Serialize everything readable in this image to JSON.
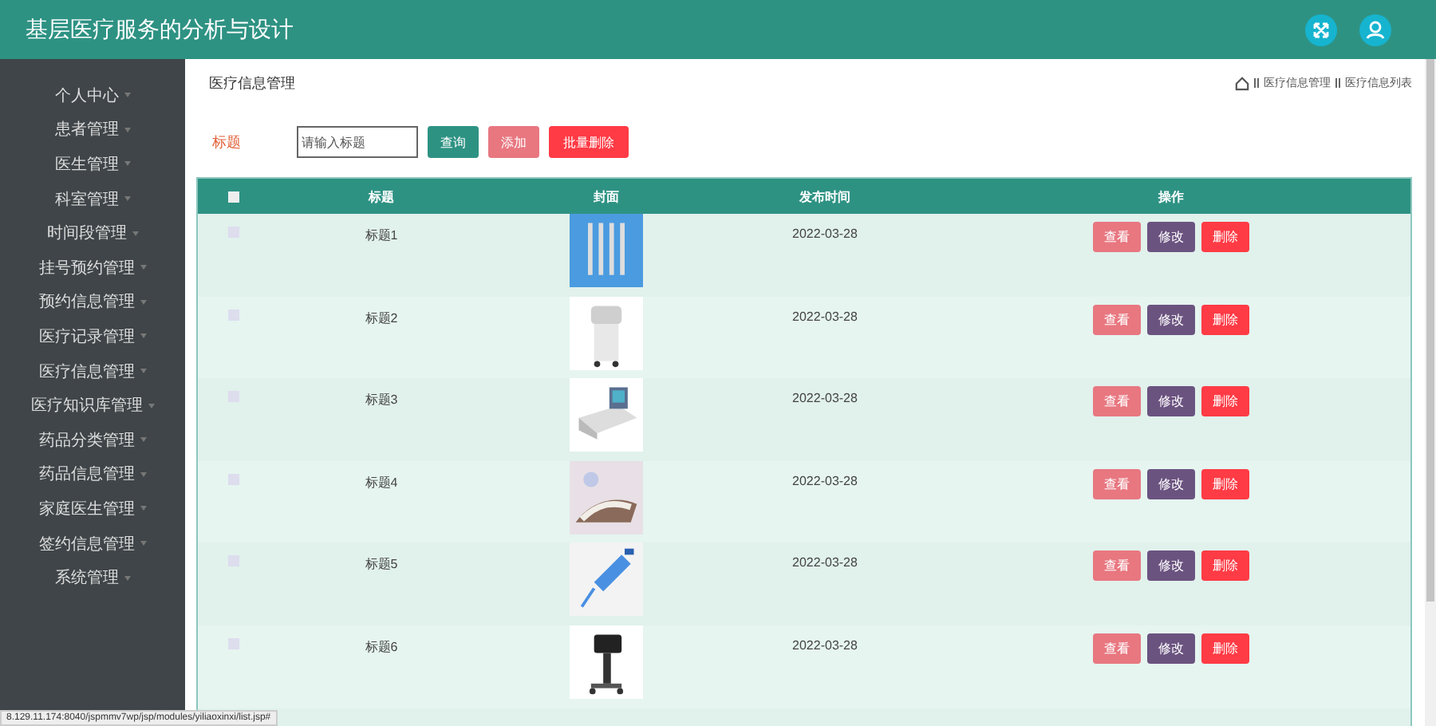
{
  "header": {
    "title": "基层医疗服务的分析与设计"
  },
  "sidebar": {
    "items": [
      {
        "label": "个人中心"
      },
      {
        "label": "患者管理"
      },
      {
        "label": "医生管理"
      },
      {
        "label": "科室管理"
      },
      {
        "label": "时间段管理"
      },
      {
        "label": "挂号预约管理"
      },
      {
        "label": "预约信息管理"
      },
      {
        "label": "医疗记录管理"
      },
      {
        "label": "医疗信息管理"
      },
      {
        "label": "医疗知识库管理"
      },
      {
        "label": "药品分类管理"
      },
      {
        "label": "药品信息管理"
      },
      {
        "label": "家庭医生管理"
      },
      {
        "label": "签约信息管理"
      },
      {
        "label": "系统管理"
      }
    ]
  },
  "page_title": "医疗信息管理",
  "breadcrumb": [
    "医疗信息管理",
    "医疗信息列表"
  ],
  "search": {
    "label": "标题",
    "placeholder": "请输入标题",
    "buttons": [
      {
        "label": "查询",
        "kind": "search"
      },
      {
        "label": "添加",
        "kind": "add"
      },
      {
        "label": "批量删除",
        "kind": "delete"
      }
    ]
  },
  "table": {
    "select_all": {
      "checked": false
    },
    "columns": [
      "标题",
      "封面",
      "发布时间",
      "操作"
    ],
    "rows": [
      {
        "title": "标题1",
        "date": "2022-03-28",
        "checked": false,
        "actions": [
          "查看",
          "修改",
          "删除"
        ]
      },
      {
        "title": "标题2",
        "date": "2022-03-28",
        "checked": false,
        "actions": [
          "查看",
          "修改",
          "删除"
        ]
      },
      {
        "title": "标题3",
        "date": "2022-03-28",
        "checked": false,
        "actions": [
          "查看",
          "修改",
          "删除"
        ]
      },
      {
        "title": "标题4",
        "date": "2022-03-28",
        "checked": false,
        "actions": [
          "查看",
          "修改",
          "删除"
        ]
      },
      {
        "title": "标题5",
        "date": "2022-03-28",
        "checked": false,
        "actions": [
          "查看",
          "修改",
          "删除"
        ]
      },
      {
        "title": "标题6",
        "date": "2022-03-28",
        "checked": false,
        "actions": [
          "查看",
          "修改",
          "删除"
        ]
      }
    ]
  },
  "status_url": "8.129.11.174:8040/jspmmv7wp/jsp/modules/yiliaoxinxi/list.jsp#"
}
